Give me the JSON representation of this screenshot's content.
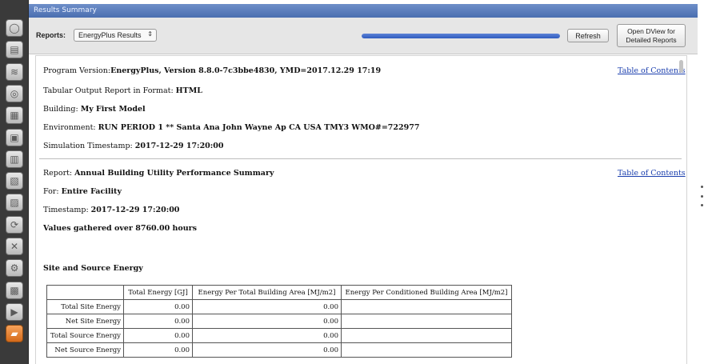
{
  "window": {
    "title": "Results Summary"
  },
  "sidebar": {
    "icons": [
      {
        "name": "site-icon",
        "glyph": "◯"
      },
      {
        "name": "schedules-icon",
        "glyph": "▤"
      },
      {
        "name": "constructions-icon",
        "glyph": "≋"
      },
      {
        "name": "loads-icon",
        "glyph": "◎"
      },
      {
        "name": "space-types-icon",
        "glyph": "▦"
      },
      {
        "name": "geometry-icon",
        "glyph": "▣"
      },
      {
        "name": "facility-icon",
        "glyph": "▥"
      },
      {
        "name": "spaces-icon",
        "glyph": "▧"
      },
      {
        "name": "thermal-zones-icon",
        "glyph": "▨"
      },
      {
        "name": "hvac-systems-icon",
        "glyph": "⟳"
      },
      {
        "name": "variables-icon",
        "glyph": "✕"
      },
      {
        "name": "simulation-settings-icon",
        "glyph": "⚙"
      },
      {
        "name": "measures-icon",
        "glyph": "▩"
      },
      {
        "name": "run-simulation-icon",
        "glyph": "▶"
      },
      {
        "name": "results-summary-icon",
        "glyph": "▰"
      }
    ],
    "active_index": 14
  },
  "toolbar": {
    "reports_label": "Reports:",
    "reports_selected": "EnergyPlus Results",
    "refresh_label": "Refresh",
    "dview_line1": "Open DView for",
    "dview_line2": "Detailed Reports",
    "progress": 1.0
  },
  "report": {
    "program_version_label": "Program Version:",
    "program_version": "EnergyPlus, Version 8.8.0-7c3bbe4830, YMD=2017.12.29 17:19",
    "format_label": "Tabular Output Report in Format: ",
    "format": "HTML",
    "building_label": "Building: ",
    "building": "My First Model",
    "environment_label": "Environment: ",
    "environment": "RUN PERIOD 1 ** Santa Ana John Wayne Ap CA USA TMY3 WMO#=722977",
    "sim_timestamp_label": "Simulation Timestamp: ",
    "sim_timestamp": "2017-12-29 17:20:00",
    "toc_label": "Table of Contents",
    "report_label": "Report: ",
    "report_name": "Annual Building Utility Performance Summary",
    "for_label": "For: ",
    "for_value": "Entire Facility",
    "timestamp_label": "Timestamp: ",
    "timestamp": "2017-12-29 17:20:00",
    "values_gathered": "Values gathered over 8760.00 hours",
    "section_heading": "Site and Source Energy",
    "table": {
      "headers": [
        "",
        "Total Energy [GJ]",
        "Energy Per Total Building Area [MJ/m2]",
        "Energy Per Conditioned Building Area [MJ/m2]"
      ],
      "rows": [
        [
          "Total Site Energy",
          "0.00",
          "0.00",
          ""
        ],
        [
          "Net Site Energy",
          "0.00",
          "0.00",
          ""
        ],
        [
          "Total Source Energy",
          "0.00",
          "0.00",
          ""
        ],
        [
          "Net Source Energy",
          "0.00",
          "0.00",
          ""
        ]
      ]
    }
  },
  "colors": {
    "titlebar": "#4a6eb0",
    "link": "#1b3fae",
    "progress": "#2f5cbf",
    "active_tab": "#d46a1a"
  }
}
